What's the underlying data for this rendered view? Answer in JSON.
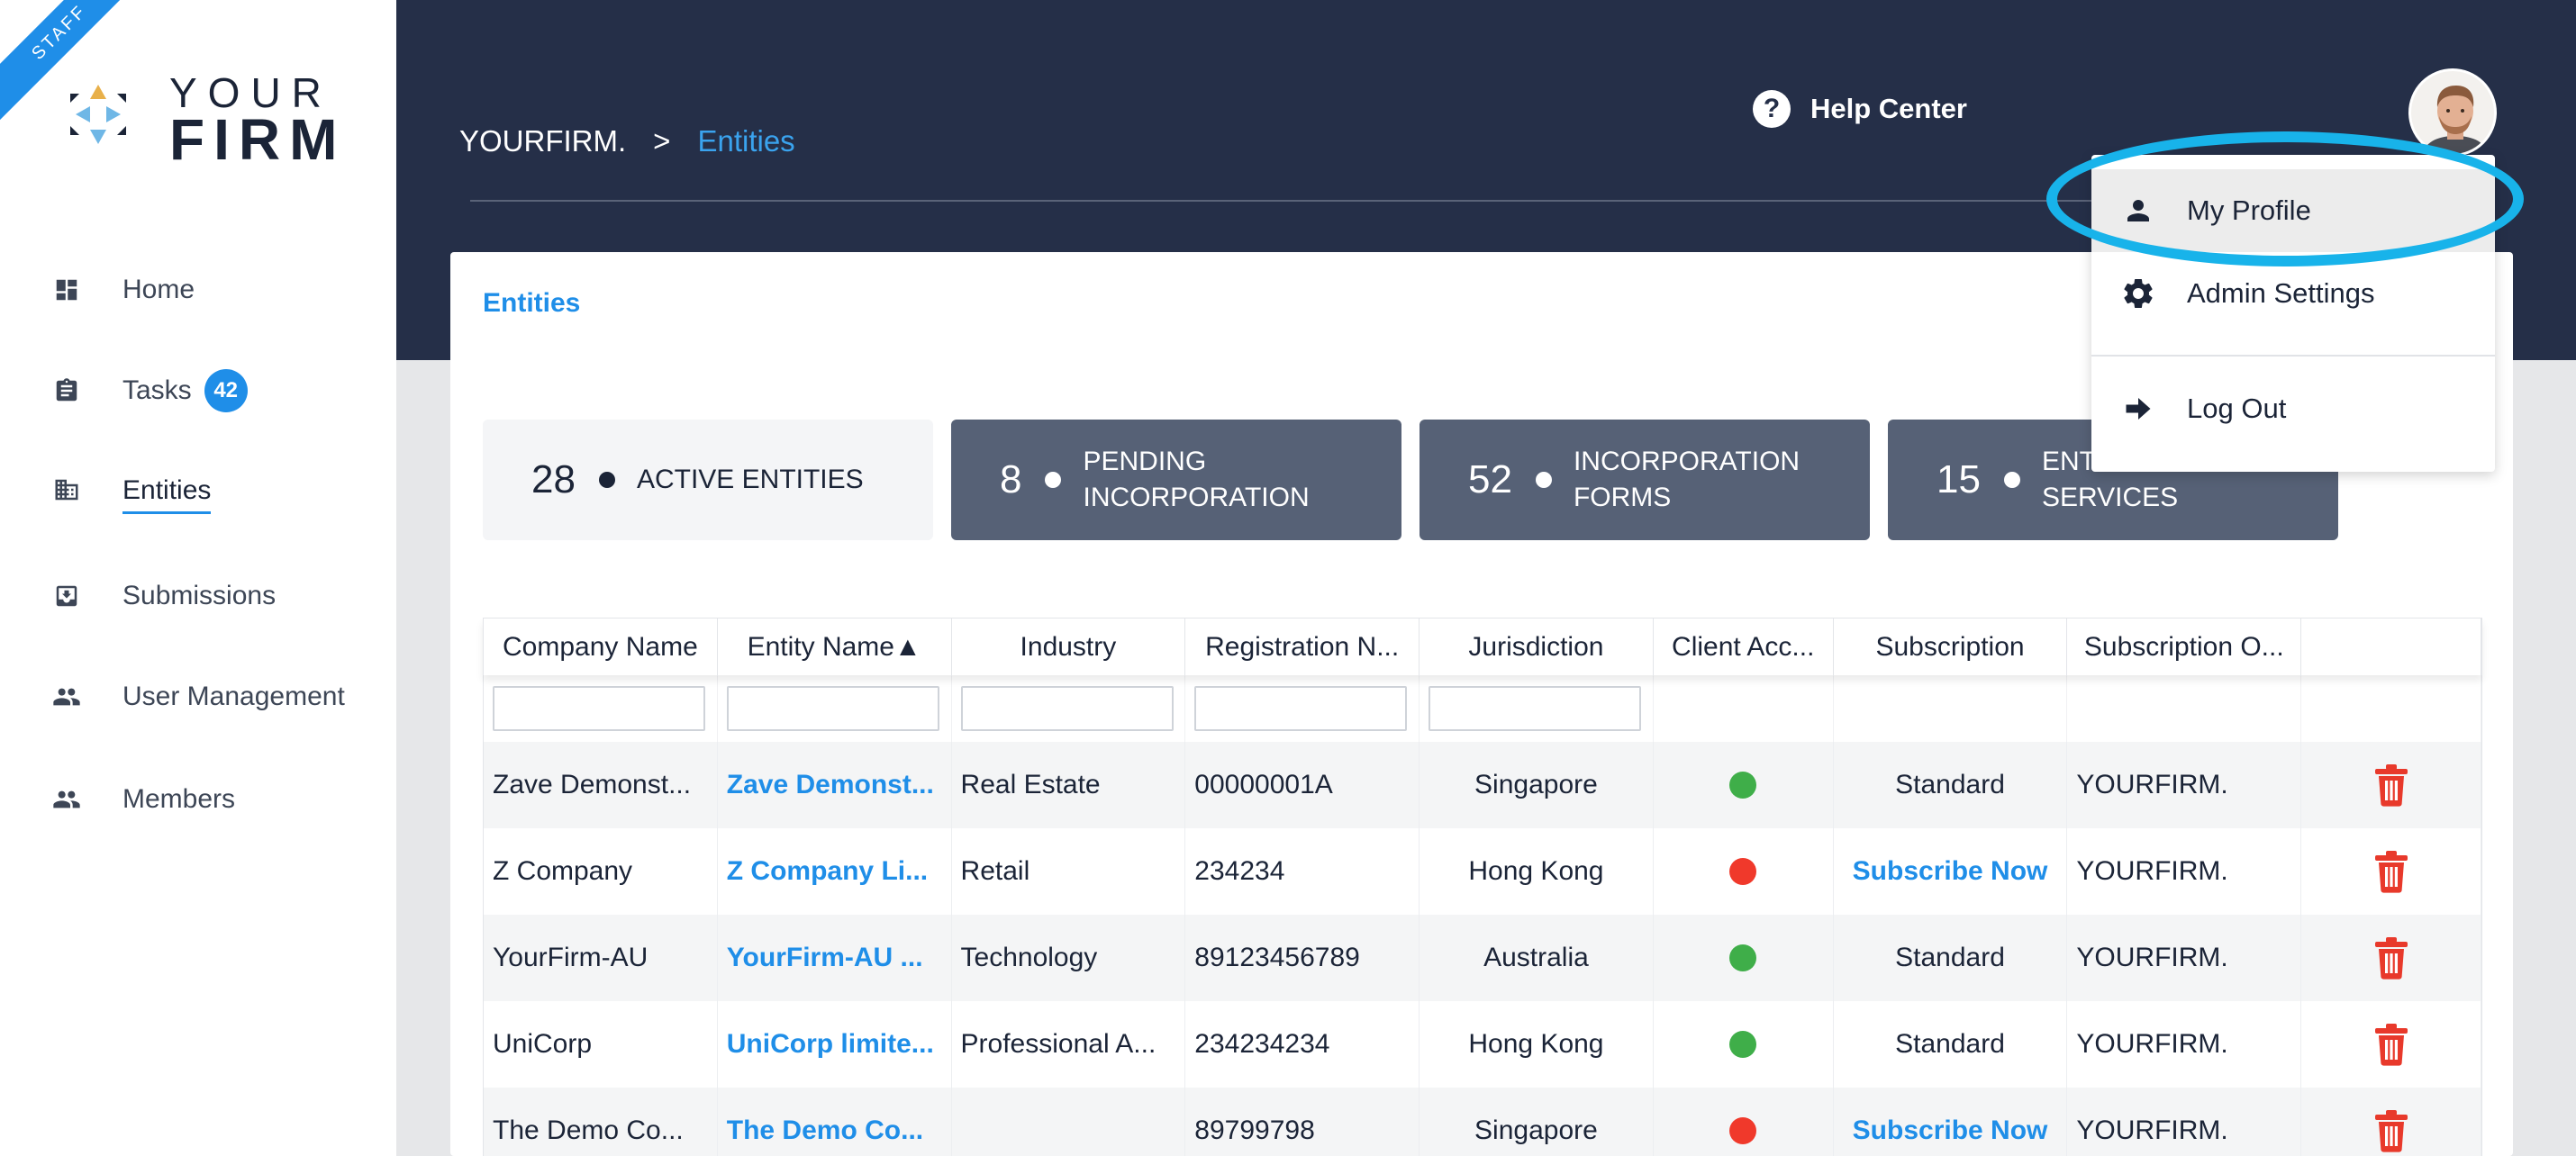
{
  "sidebar": {
    "staff_ribbon": "STAFF",
    "logo": {
      "line1": "YOUR",
      "line2": "FIRM"
    },
    "items": [
      {
        "label": "Home",
        "icon": "dashboard-icon"
      },
      {
        "label": "Tasks",
        "icon": "clipboard-icon",
        "badge": "42"
      },
      {
        "label": "Entities",
        "icon": "building-icon",
        "active": true
      },
      {
        "label": "Submissions",
        "icon": "inbox-download-icon"
      },
      {
        "label": "User Management",
        "icon": "users-icon"
      },
      {
        "label": "Members",
        "icon": "group-icon"
      }
    ]
  },
  "header": {
    "breadcrumb": {
      "root": "YOURFIRM.",
      "separator": ">",
      "current": "Entities"
    },
    "help_center": "Help Center",
    "help_icon": "?"
  },
  "profile_menu": {
    "items": [
      {
        "label": "My Profile",
        "icon": "person-icon"
      },
      {
        "label": "Admin Settings",
        "icon": "gear-icon"
      },
      {
        "label": "Log Out",
        "icon": "arrow-right-icon"
      }
    ]
  },
  "main": {
    "title": "Entities",
    "stats": [
      {
        "count": "28",
        "label": "ACTIVE ENTITIES"
      },
      {
        "count": "8",
        "label": "PENDING INCORPORATION"
      },
      {
        "count": "52",
        "label": "INCORPORATION FORMS"
      },
      {
        "count": "15",
        "label": "ENTITIES WITH NO SERVICES"
      }
    ],
    "table": {
      "columns": [
        "Company Name",
        "Entity Name▲",
        "Industry",
        "Registration N...",
        "Jurisdiction",
        "Client Acc...",
        "Subscription",
        "Subscription O...",
        ""
      ],
      "rows": [
        {
          "company": "Zave Demonst...",
          "entity": "Zave Demonst...",
          "industry": "Real Estate",
          "reg": "00000001A",
          "juris": "Singapore",
          "client": "green",
          "subscription": "Standard",
          "sub_link": false,
          "sub_owner": "YOURFIRM."
        },
        {
          "company": "Z Company",
          "entity": "Z Company Li...",
          "industry": "Retail",
          "reg": "234234",
          "juris": "Hong Kong",
          "client": "red",
          "subscription": "Subscribe Now",
          "sub_link": true,
          "sub_owner": "YOURFIRM."
        },
        {
          "company": "YourFirm-AU",
          "entity": "YourFirm-AU ...",
          "industry": "Technology",
          "reg": "89123456789",
          "juris": "Australia",
          "client": "green",
          "subscription": "Standard",
          "sub_link": false,
          "sub_owner": "YOURFIRM."
        },
        {
          "company": "UniCorp",
          "entity": "UniCorp limite...",
          "industry": "Professional A...",
          "reg": "234234234",
          "juris": "Hong Kong",
          "client": "green",
          "subscription": "Standard",
          "sub_link": false,
          "sub_owner": "YOURFIRM."
        },
        {
          "company": "The Demo Co...",
          "entity": "The Demo Co...",
          "industry": "",
          "reg": "89799798",
          "juris": "Singapore",
          "client": "red",
          "subscription": "Subscribe Now",
          "sub_link": true,
          "sub_owner": "YOURFIRM."
        }
      ]
    }
  },
  "colors": {
    "accent": "#1f8ee8",
    "header_bg": "#252f48",
    "stat_bg": "#566176",
    "status_green": "#3fae49",
    "status_red": "#f0392b",
    "delete_red": "#e8392b",
    "highlight": "#18b3ea"
  }
}
